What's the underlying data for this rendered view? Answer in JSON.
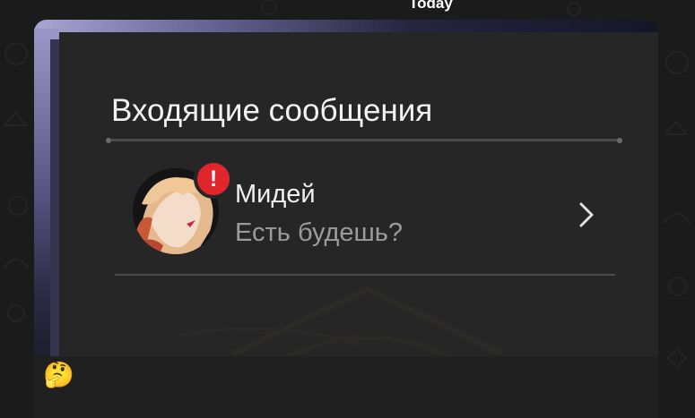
{
  "chat": {
    "date_label": "Today"
  },
  "inbox_card": {
    "title": "Входящие сообщения",
    "items": [
      {
        "sender": "Мидей",
        "preview": "Есть будешь?",
        "badge": "!"
      }
    ]
  },
  "message": {
    "emoji": "🤔"
  },
  "colors": {
    "background": "#1b1b1c",
    "card": "#262627",
    "badge": "#e0262b",
    "accent_gradient_start": "#aaa6d2",
    "accent_gradient_end": "#141628"
  },
  "icons": {
    "badge": "exclamation-badge-icon",
    "chevron": "chevron-right-icon"
  }
}
